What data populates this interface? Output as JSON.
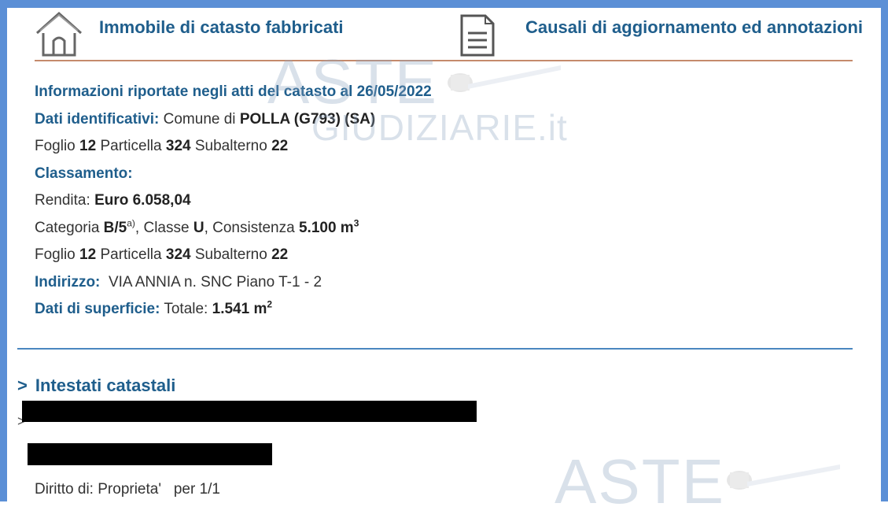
{
  "header": {
    "left_title": "Immobile di catasto fabbricati",
    "right_title": "Causali di aggiornamento ed annotazioni",
    "left_icon": "house-icon",
    "right_icon": "document-icon"
  },
  "info": {
    "heading": "Informazioni riportate negli atti del catasto al 26/05/2022",
    "dati_label": "Dati identificativi:",
    "comune_prefix": "Comune di",
    "comune_value": "POLLA (G793) (SA)",
    "foglio1_label": "Foglio",
    "foglio1_value": "12",
    "particella1_label": "Particella",
    "particella1_value": "324",
    "subalterno1_label": "Subalterno",
    "subalterno1_value": "22",
    "classamento_label": "Classamento:",
    "rendita_label": "Rendita:",
    "rendita_value": "Euro 6.058,04",
    "categoria_label": "Categoria",
    "categoria_value": "B/5",
    "categoria_sup": "a)",
    "classe_label": ", Classe",
    "classe_value": "U",
    "consistenza_label": ", Consistenza",
    "consistenza_value": "5.100 m",
    "consistenza_sup": "3",
    "foglio2_label": "Foglio",
    "foglio2_value": "12",
    "particella2_label": "Particella",
    "particella2_value": "324",
    "subalterno2_label": "Subalterno",
    "subalterno2_value": "22",
    "indirizzo_label": "Indirizzo:",
    "indirizzo_value": "VIA ANNIA n. SNC Piano T-1 - 2",
    "superficie_label": "Dati di superficie:",
    "superficie_totale_label": "Totale:",
    "superficie_value": "1.541 m",
    "superficie_sup": "2"
  },
  "intestati": {
    "chevron": ">",
    "title": "Intestati catastali",
    "item_chevron": ">",
    "diritto_label": "Diritto di:",
    "diritto_value": "Proprieta'",
    "quota": "per 1/1"
  },
  "watermark": {
    "line1": "ASTE",
    "line2": "GIUDIZIARIE.it"
  },
  "colors": {
    "frame": "#5b8fd6",
    "label_blue": "#1f5e8c",
    "rule_orange": "#c58a6c",
    "rule_blue": "#4a87c0"
  }
}
